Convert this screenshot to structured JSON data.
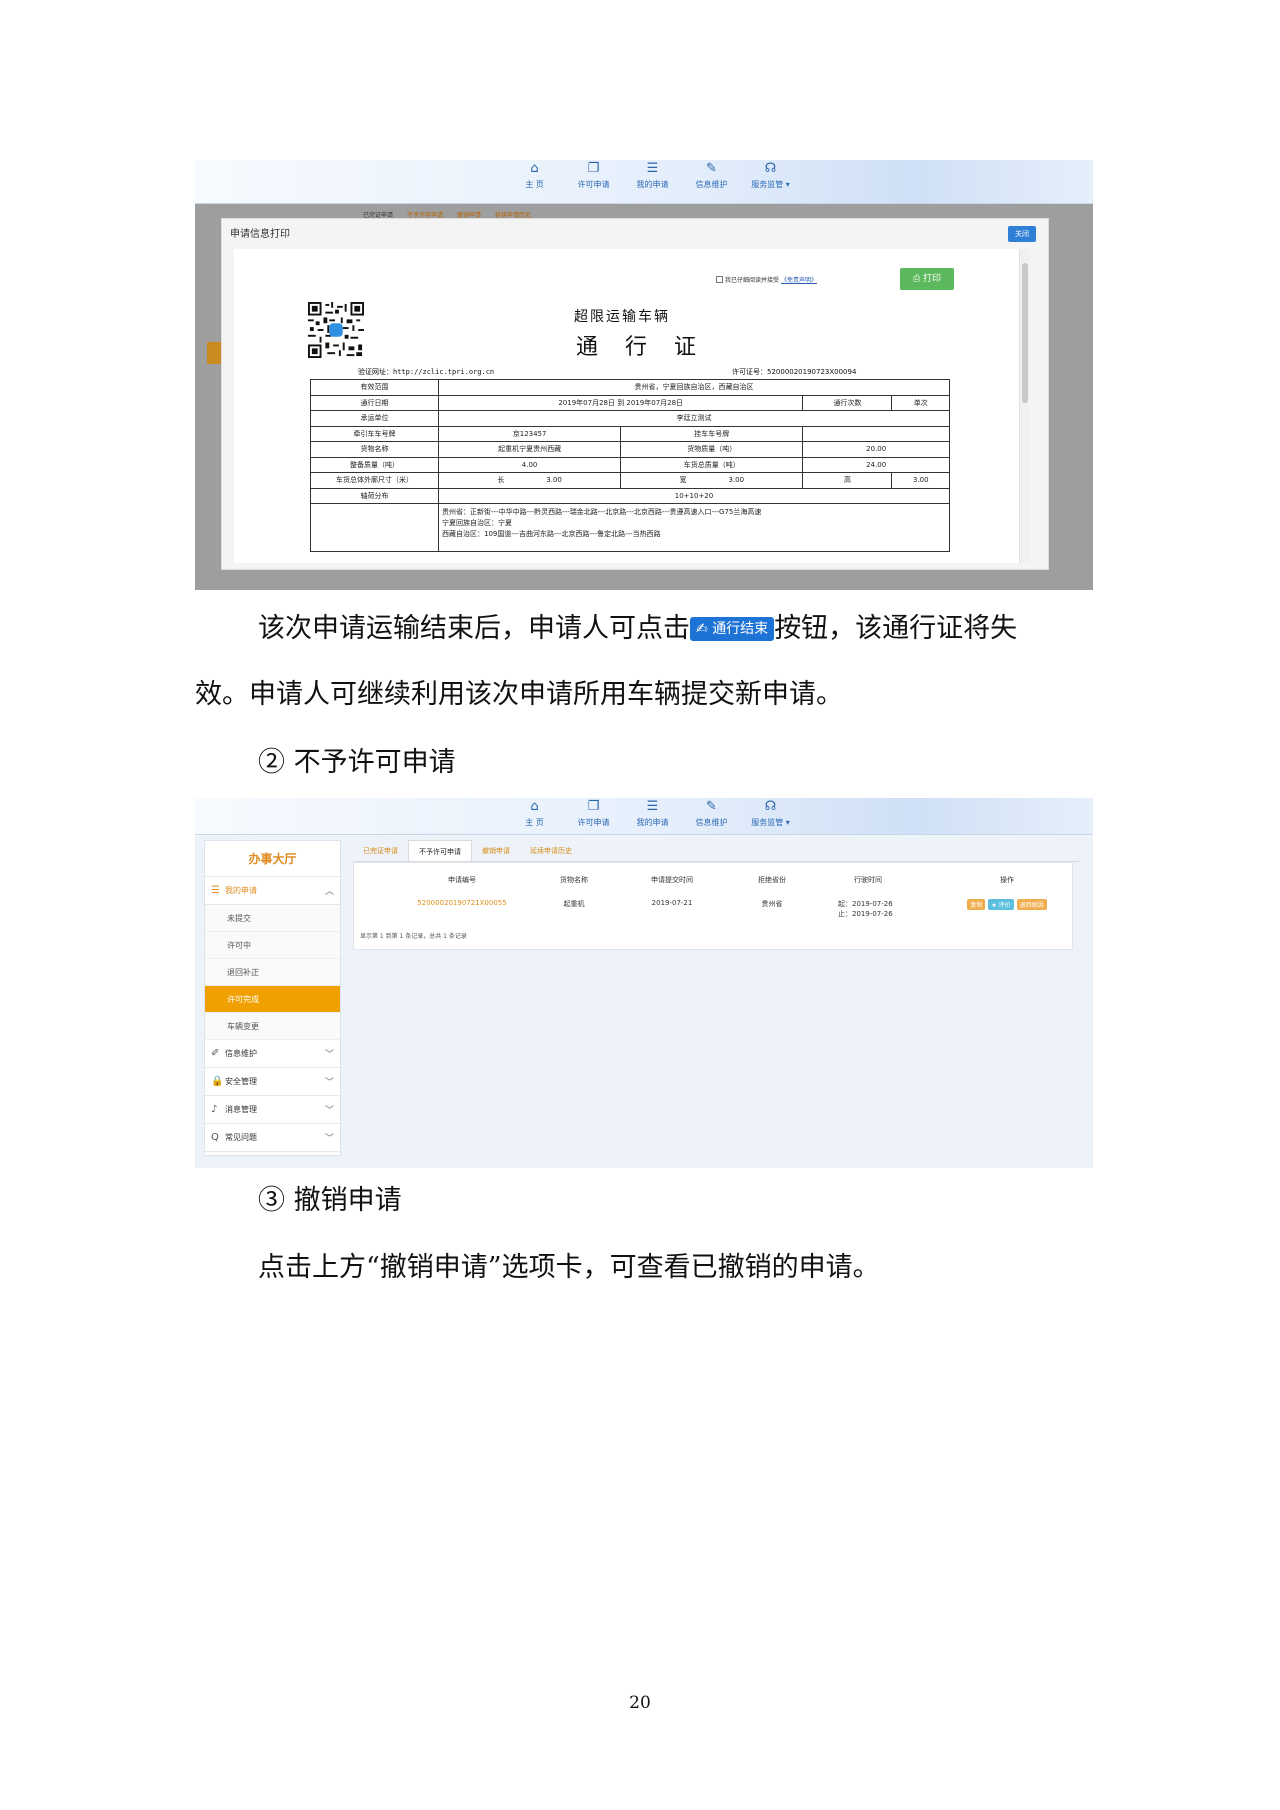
{
  "nav": [
    {
      "icon": "home-icon",
      "glyph": "⌂",
      "label": "主 页"
    },
    {
      "icon": "copy-icon",
      "glyph": "❐",
      "label": "许可申请"
    },
    {
      "icon": "list-icon",
      "glyph": "☰",
      "label": "我的申请"
    },
    {
      "icon": "edit-icon",
      "glyph": "✎",
      "label": "信息维护"
    },
    {
      "icon": "headset-icon",
      "glyph": "☊",
      "label": "服务监管 ▾"
    }
  ],
  "modal": {
    "title": "申请信息打印",
    "close_label": "关闭",
    "agree_text": "我已仔细阅读并接受",
    "agree_link": "《免责声明》",
    "print_label": "打印",
    "doc_title_line1": "超限运输车辆",
    "doc_title_line2": "通 行 证",
    "verify_url": "验证网址：http://zclic.tpri.org.cn",
    "permit_no": "许可证号：52000020190723X00094",
    "bg_tabs": [
      "已完证申请",
      "不予许可申请",
      "撤销申请",
      "延续申请历史"
    ]
  },
  "permit_table": {
    "r1": {
      "label": "有效范围",
      "value": "贵州省，宁夏回族自治区，西藏自治区"
    },
    "r2": {
      "label": "通行日期",
      "value": "2019年07月28日 到 2019年07月28日",
      "label2": "通行次数",
      "value2": "单次"
    },
    "r3": {
      "label": "承运单位",
      "value": "李廷立测试"
    },
    "r4": {
      "label": "牵引车车号牌",
      "value": "京123457",
      "label2": "挂车车号牌",
      "value2": ""
    },
    "r5": {
      "label": "货物名称",
      "value": "起重机宁夏贵州西藏",
      "label2": "货物质量（吨）",
      "value2": "20.00"
    },
    "r6": {
      "label": "整备质量（吨）",
      "value": "4.00",
      "label2": "车货总质量（吨）",
      "value2": "24.00"
    },
    "r7": {
      "label": "车货总体外廓尺寸（米）",
      "l": "长",
      "lv": "3.00",
      "w": "宽",
      "wv": "3.00",
      "h": "高",
      "hv": "3.00"
    },
    "r8": {
      "label": "轴荷分布",
      "value": "10+10+20"
    },
    "route1": "贵州省：正新街---中华中路---黔灵西路---瑞金北路---北京路---北京西路---贵遵高速入口---G75兰海高速",
    "route2": "宁夏回族自治区：宁夏",
    "route3": "西藏自治区：109国道---吉曲河东路---北京西路---鲁定北路---当热西路"
  },
  "para1_a": "该次申请运输结束后，申请人可点击",
  "inline_button": "通行结束",
  "para1_b": "按钮，该通行证将失",
  "para2": "效。申请人可继续利用该次申请所用车辆提交新申请。",
  "heading2": "② 不予许可申请",
  "sidebar": {
    "title": "办事大厅",
    "my_apply": "我的申请",
    "subs": [
      "未提交",
      "许可中",
      "退回补正",
      "许可完成",
      "车辆变更"
    ],
    "groups": [
      {
        "icon": "wrench-icon",
        "glyph": "✐",
        "label": "信息维护"
      },
      {
        "icon": "lock-icon",
        "glyph": "🔒",
        "label": "安全管理"
      },
      {
        "icon": "bell-icon",
        "glyph": "♪",
        "label": "消息管理"
      },
      {
        "icon": "question-icon",
        "glyph": "Q",
        "label": "常见问题"
      }
    ]
  },
  "tabs": [
    "已完证申请",
    "不予许可申请",
    "撤销申请",
    "延续申请历史"
  ],
  "list": {
    "headers": [
      "申请编号",
      "货物名称",
      "申请提交时间",
      "拒绝省份",
      "行驶时间",
      "操作"
    ],
    "row": {
      "id": "52000020190721X00055",
      "cargo": "起重机",
      "submit": "2019-07-21",
      "province": "贵州省",
      "start": "起：2019-07-26",
      "end": "止：2019-07-26"
    },
    "ops": [
      "复制",
      "★ 评价",
      "退回原因"
    ],
    "pager": "显示第 1 到第 1 条记录，总共 1 条记录"
  },
  "heading3": "③ 撤销申请",
  "para3": "点击上方“撤销申请”选项卡，可查看已撤销的申请。",
  "page_number": "20"
}
